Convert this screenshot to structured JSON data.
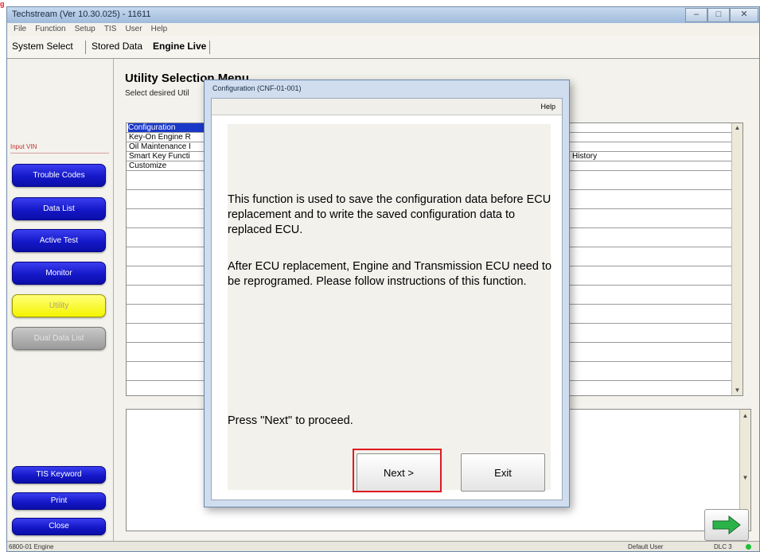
{
  "window": {
    "title": "Techstream (Ver 10.30.025) - 11611",
    "minimize": "–",
    "maximize": "□",
    "close": "✕"
  },
  "menu": [
    "File",
    "Function",
    "Setup",
    "TIS",
    "User",
    "Help"
  ],
  "tabs": [
    "System Select",
    "Stored Data",
    "Engine Live"
  ],
  "sidebar": {
    "input_vin": "Input VIN",
    "buttons": [
      "Trouble Codes",
      "Data List",
      "Active Test",
      "Monitor",
      "Utility",
      "Dual Data List"
    ],
    "bottom_buttons": [
      "TIS Keyword",
      "Print",
      "Close"
    ]
  },
  "main": {
    "title": "Utility Selection Menu",
    "subtitle": "Select desired Util",
    "items": [
      "Configuration",
      "Key-On Engine R",
      "Oil Maintenance I",
      "Smart Key Functi",
      "Customize"
    ],
    "right_text": "History"
  },
  "dialog": {
    "title": "Configuration (CNF-01-001)",
    "help": "Help",
    "paragraph1": "This function is used to save the configuration data before ECU replacement and to write the saved configuration data to replaced ECU.",
    "paragraph2": "After ECU replacement, Engine and Transmission ECU need to be reprogramed. Please follow instructions of this function.",
    "proceed": "Press \"Next\" to proceed.",
    "next": "Next >",
    "exit": "Exit"
  },
  "status": {
    "left": "6800-01 Engine",
    "user": "Default User",
    "dlc": "DLC 3"
  },
  "colors": {
    "sidebar_button": "#1418c8",
    "utility_button": "#f4f400",
    "highlight": "#e0191f",
    "selected_row": "#1a38c8"
  }
}
